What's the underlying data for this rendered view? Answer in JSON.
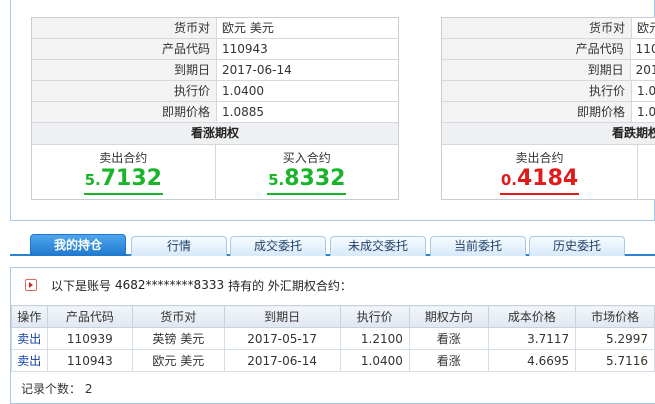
{
  "labels": {
    "pair": "货币对",
    "code": "产品代码",
    "expiry": "到期日",
    "strike": "执行价",
    "spot": "即期价格",
    "sell": "卖出合约",
    "buy": "买入合约"
  },
  "card_call": {
    "pair": "欧元 美元",
    "code": "110943",
    "expiry": "2017-06-14",
    "strike": "1.0400",
    "spot": "1.0885",
    "kind": "看涨期权",
    "sell_small": "5.",
    "sell_big": "7132",
    "buy_small": "5.",
    "buy_big": "8332"
  },
  "card_put": {
    "pair": "欧元",
    "code": "1109",
    "expiry": "2017",
    "strike": "1.04",
    "spot": "1.08",
    "kind": "看跌期权",
    "sell_small": "0.",
    "sell_big": "4184"
  },
  "colors": {
    "buy_green": "#19b42a",
    "sell_red": "#e01b1b",
    "tab_active": "#1f78cc"
  },
  "tabs": [
    {
      "label": "我的持仓",
      "active": true
    },
    {
      "label": "行情"
    },
    {
      "label": "成交委托"
    },
    {
      "label": "未成交委托"
    },
    {
      "label": "当前委托"
    },
    {
      "label": "历史委托"
    }
  ],
  "holdings": {
    "notice_prefix": "以下是账号",
    "account": "4682********8333",
    "notice_suffix": "持有的 外汇期权合约：",
    "columns": [
      "操作",
      "产品代码",
      "货币对",
      "到期日",
      "执行价",
      "期权方向",
      "成本价格",
      "市场价格"
    ],
    "rows": [
      {
        "action": "卖出",
        "code": "110939",
        "pair": "英镑 美元",
        "expiry": "2017-05-17",
        "strike": "1.2100",
        "direction": "看涨",
        "cost": "3.7117",
        "market": "5.2997"
      },
      {
        "action": "卖出",
        "code": "110943",
        "pair": "欧元 美元",
        "expiry": "2017-06-14",
        "strike": "1.0400",
        "direction": "看涨",
        "cost": "4.6695",
        "market": "5.7116"
      }
    ],
    "count_label": "记录个数：",
    "count": "2"
  }
}
